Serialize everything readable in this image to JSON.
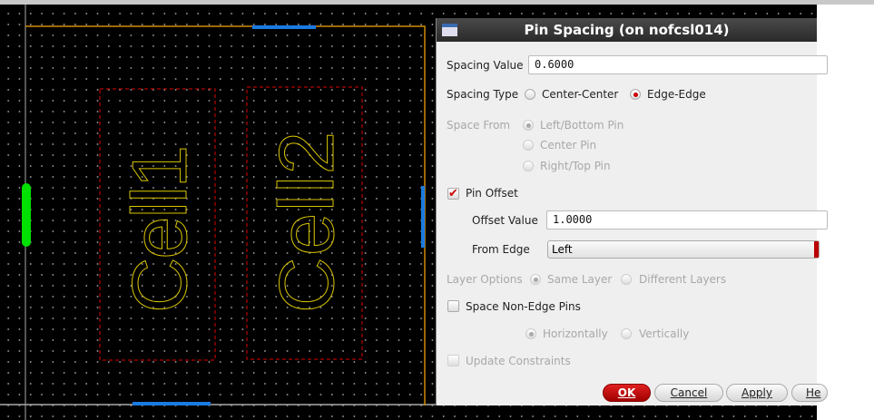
{
  "canvas": {
    "cells": [
      "Cell1",
      "Cell2"
    ],
    "colors": {
      "boundary": "#d08a00",
      "cell_outline": "#e00000",
      "label": "#d8c400",
      "pin_green": "#00e000",
      "pin_blue": "#1a7ae0"
    }
  },
  "dialog": {
    "title": "Pin Spacing (on nofcsl014)",
    "spacing_value_label": "Spacing Value",
    "spacing_value": "0.6000",
    "spacing_type_label": "Spacing Type",
    "spacing_type_options": [
      "Center-Center",
      "Edge-Edge"
    ],
    "space_from_label": "Space From",
    "space_from_options": [
      "Left/Bottom Pin",
      "Center Pin",
      "Right/Top Pin"
    ],
    "pin_offset_label": "Pin Offset",
    "offset_value_label": "Offset Value",
    "offset_value": "1.0000",
    "from_edge_label": "From Edge",
    "from_edge_value": "Left",
    "layer_options_label": "Layer Options",
    "layer_options": [
      "Same Layer",
      "Different Layers"
    ],
    "space_non_edge_label": "Space Non-Edge Pins",
    "direction_options": [
      "Horizontally",
      "Vertically"
    ],
    "update_constraints_label": "Update Constraints",
    "buttons": {
      "ok": "OK",
      "cancel": "Cancel",
      "apply": "Apply",
      "help": "He"
    }
  }
}
